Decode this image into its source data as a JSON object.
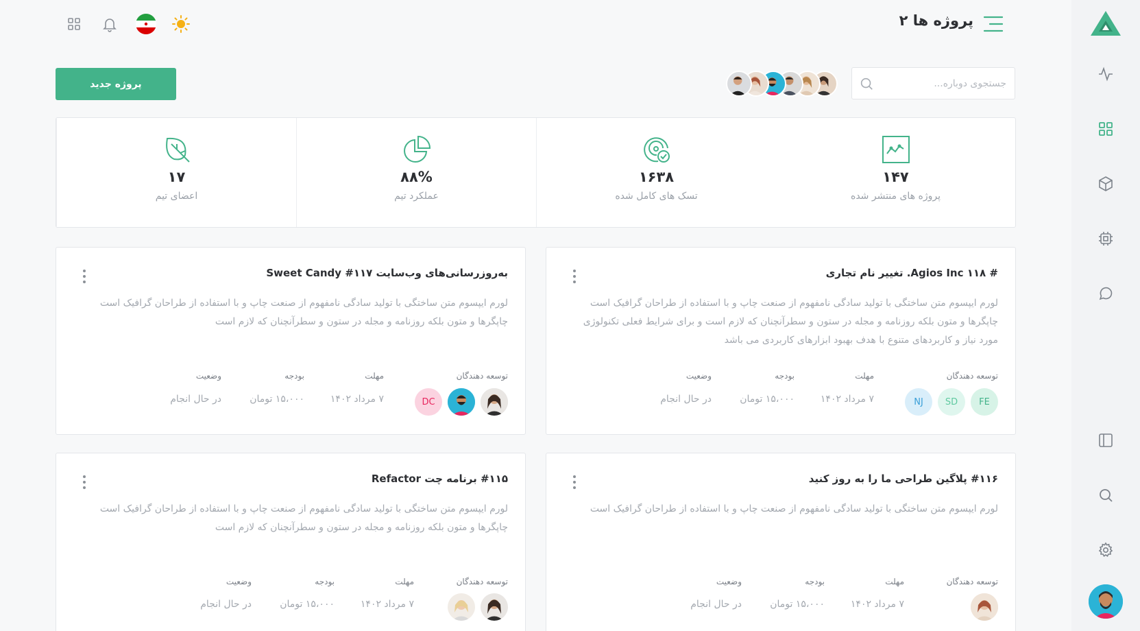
{
  "header": {
    "title": "پروژه ها ۲"
  },
  "toolbar": {
    "search_placeholder": "جستجوی دوباره...",
    "new_project_label": "پروژه جدید"
  },
  "stats": [
    {
      "value": "۱۴۷",
      "label": "پروژه های منتشر شده",
      "icon": "chart-icon"
    },
    {
      "value": "۱۶۳۸",
      "label": "تسک های کامل شده",
      "icon": "target-check-icon"
    },
    {
      "value": "۸۸%",
      "label": "عملکرد تیم",
      "icon": "pie-icon"
    },
    {
      "value": "۱۷",
      "label": "اعضای تیم",
      "icon": "leaf-icon"
    }
  ],
  "labels": {
    "developers": "توسعه دهندگان",
    "deadline": "مهلت",
    "budget": "بودجه",
    "status": "وضعیت"
  },
  "cards": [
    {
      "title": "# Agios Inc ۱۱۸. تغییر نام تجاری",
      "description": "لورم ایپسوم متن ساختگی با تولید سادگی نامفهوم از صنعت چاپ و با استفاده از طراحان گرافیک است چاپگرها و متون بلکه روزنامه و مجله در ستون و سطرآنچنان که لازم است و برای شرایط فعلی تکنولوژی مورد نیاز و کاربردهای متنوع با هدف بهبود ابزارهای کاربردی می باشد",
      "developers": [
        "FE",
        "SD",
        "NJ"
      ],
      "deadline": "۷ مرداد ۱۴۰۲",
      "budget": "۱۵،۰۰۰ تومان",
      "status": "در حال انجام"
    },
    {
      "title": "به‌روزرسانی‌های وب‌سایت Sweet Candy #۱۱۷",
      "description": "لورم ایپسوم متن ساختگی با تولید سادگی نامفهوم از صنعت چاپ و با استفاده از طراحان گرافیک است چاپگرها و متون بلکه روزنامه و مجله در ستون و سطرآنچنان که لازم است",
      "developers": [
        "DC"
      ],
      "deadline": "۷ مرداد ۱۴۰۲",
      "budget": "۱۵،۰۰۰ تومان",
      "status": "در حال انجام"
    },
    {
      "title": "#۱۱۶ پلاگین طراحی ما را به روز کنید",
      "description": "لورم ایپسوم متن ساختگی با تولید سادگی نامفهوم از صنعت چاپ و با استفاده از طراحان گرافیک است",
      "developers": [],
      "deadline": "۷ مرداد ۱۴۰۲",
      "budget": "۱۵،۰۰۰ تومان",
      "status": "در حال انجام"
    },
    {
      "title": "#۱۱۵ برنامه چت Refactor",
      "description": "لورم ایپسوم متن ساختگی با تولید سادگی نامفهوم از صنعت چاپ و با استفاده از طراحان گرافیک است چاپگرها و متون بلکه روزنامه و مجله در ستون و سطرآنچنان که لازم است",
      "developers": [],
      "deadline": "۷ مرداد ۱۴۰۲",
      "budget": "۱۵،۰۰۰ تومان",
      "status": "در حال انجام"
    }
  ],
  "colors": {
    "accent": "#43b38a",
    "sidebar_active": "#43b38a",
    "text_muted": "#a3a8af"
  }
}
